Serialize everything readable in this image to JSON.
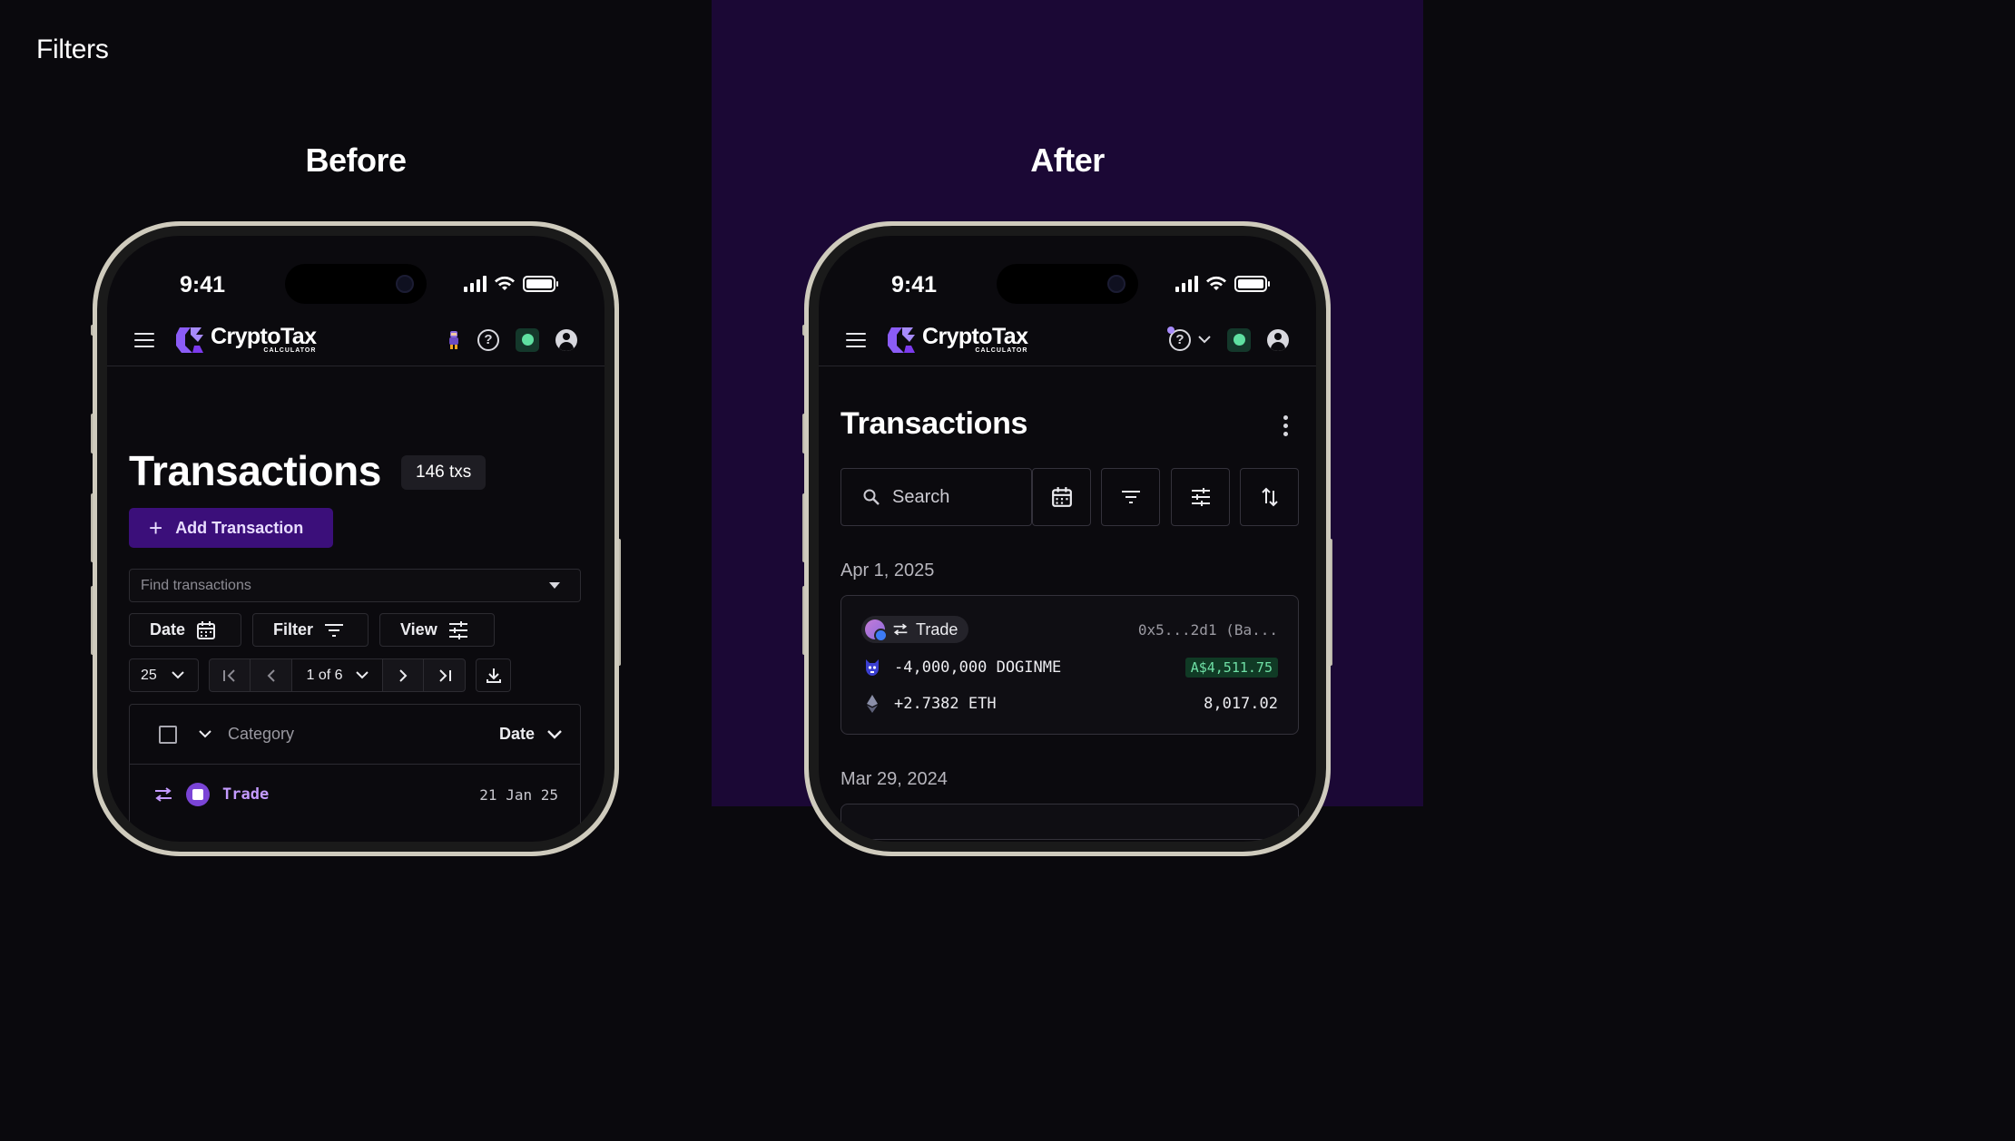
{
  "page": {
    "title": "Filters",
    "before_label": "Before",
    "after_label": "After"
  },
  "status_bar": {
    "time": "9:41"
  },
  "app": {
    "logo_name": "CryptoTax",
    "logo_sub": "CALCULATOR"
  },
  "before": {
    "title": "Transactions",
    "count_badge": "146 txs",
    "add_button": "Add Transaction",
    "find_placeholder": "Find transactions",
    "date_button": "Date",
    "filter_button": "Filter",
    "view_button": "View",
    "page_size": "25",
    "page_indicator": "1 of 6",
    "table": {
      "col_category": "Category",
      "col_date": "Date",
      "rows": [
        {
          "category": "Trade",
          "date": "21 Jan 25"
        }
      ]
    }
  },
  "after": {
    "title": "Transactions",
    "search_placeholder": "Search",
    "groups": [
      {
        "date": "Apr 1, 2025",
        "tx": {
          "type": "Trade",
          "hash": "0x5...2d1 (Ba...",
          "lines": [
            {
              "amount": "-4,000,000 DOGINME",
              "value": "A$4,511.75"
            },
            {
              "amount": "+2.7382 ETH",
              "value": "8,017.02"
            }
          ]
        }
      },
      {
        "date": "Mar 29, 2024"
      }
    ]
  },
  "colors": {
    "left_bg": "#0a090d",
    "right_bg": "#1b0835",
    "accent_purple": "#3b0f7a",
    "trade_purple": "#c49bff",
    "sync_green": "#5fe0a1",
    "value_green": "#6fe0a6"
  }
}
